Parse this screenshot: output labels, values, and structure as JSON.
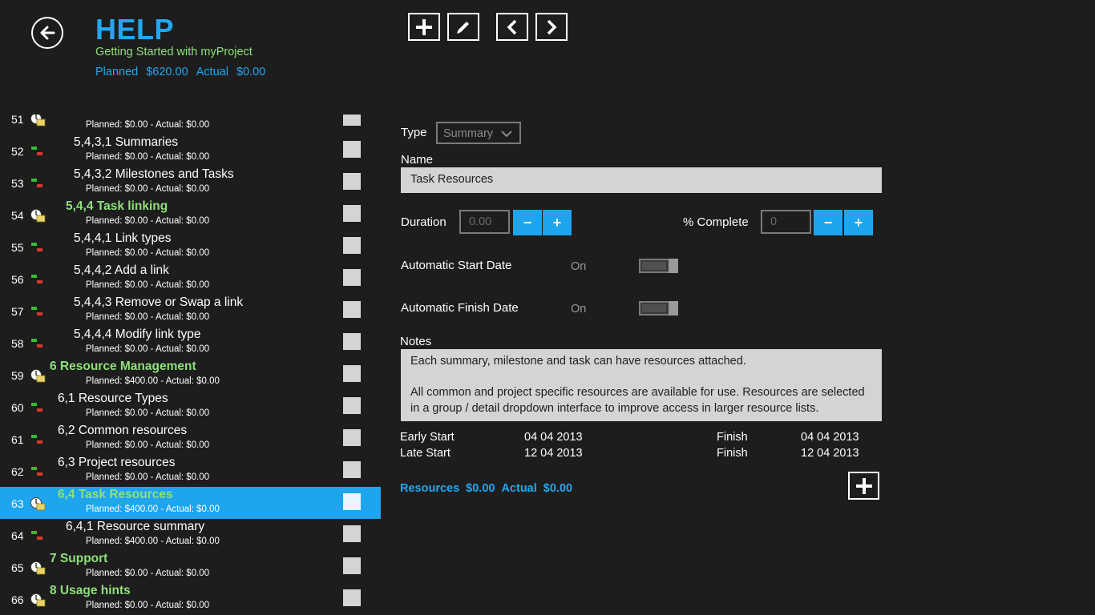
{
  "header": {
    "title": "HELP",
    "subtitle": "Getting Started with myProject",
    "planned_label": "Planned",
    "planned_value": "$620.00",
    "actual_label": "Actual",
    "actual_value": "$0.00"
  },
  "toolbar": {
    "add_icon": "plus-icon",
    "edit_icon": "pencil-icon",
    "prev_icon": "chevron-left-icon",
    "next_icon": "chevron-right-icon"
  },
  "tasks": [
    {
      "num": "51",
      "name": "",
      "cost": "Planned: $0.00  -  Actual: $0.00",
      "summary": true,
      "indent": 0
    },
    {
      "num": "52",
      "name": "5,4,3,1 Summaries",
      "cost": "Planned: $0.00  -  Actual: $0.00",
      "summary": false,
      "indent": 3
    },
    {
      "num": "53",
      "name": "5,4,3,2 Milestones and Tasks",
      "cost": "Planned: $0.00  -  Actual: $0.00",
      "summary": false,
      "indent": 3
    },
    {
      "num": "54",
      "name": "5,4,4 Task linking",
      "cost": "Planned: $0.00  -  Actual: $0.00",
      "summary": true,
      "indent": 2
    },
    {
      "num": "55",
      "name": "5,4,4,1 Link types",
      "cost": "Planned: $0.00  -  Actual: $0.00",
      "summary": false,
      "indent": 3
    },
    {
      "num": "56",
      "name": "5,4,4,2 Add a link",
      "cost": "Planned: $0.00  -  Actual: $0.00",
      "summary": false,
      "indent": 3
    },
    {
      "num": "57",
      "name": "5,4,4,3 Remove or Swap a link",
      "cost": "Planned: $0.00  -  Actual: $0.00",
      "summary": false,
      "indent": 3
    },
    {
      "num": "58",
      "name": "5,4,4,4 Modify link type",
      "cost": "Planned: $0.00  -  Actual: $0.00",
      "summary": false,
      "indent": 3
    },
    {
      "num": "59",
      "name": "6 Resource Management",
      "cost": "Planned: $400.00  -  Actual: $0.00",
      "summary": true,
      "indent": 0
    },
    {
      "num": "60",
      "name": "6,1 Resource Types",
      "cost": "Planned: $0.00  -  Actual: $0.00",
      "summary": false,
      "indent": 1
    },
    {
      "num": "61",
      "name": "6,2 Common resources",
      "cost": "Planned: $0.00  -  Actual: $0.00",
      "summary": false,
      "indent": 1
    },
    {
      "num": "62",
      "name": "6,3 Project resources",
      "cost": "Planned: $0.00  -  Actual: $0.00",
      "summary": false,
      "indent": 1
    },
    {
      "num": "63",
      "name": "6,4 Task Resources",
      "cost": "Planned: $400.00  -  Actual: $0.00",
      "summary": true,
      "indent": 1,
      "selected": true
    },
    {
      "num": "64",
      "name": "6,4,1 Resource summary",
      "cost": "Planned: $400.00  -  Actual: $0.00",
      "summary": false,
      "indent": 2
    },
    {
      "num": "65",
      "name": "7 Support",
      "cost": "Planned: $0.00  -  Actual: $0.00",
      "summary": true,
      "indent": 0
    },
    {
      "num": "66",
      "name": "8 Usage hints",
      "cost": "Planned: $0.00  -  Actual: $0.00",
      "summary": true,
      "indent": 0
    }
  ],
  "detail": {
    "type_label": "Type",
    "type_value": "Summary",
    "name_label": "Name",
    "name_value": "Task Resources",
    "duration_label": "Duration",
    "duration_placeholder": "0.00",
    "complete_label": "% Complete",
    "complete_placeholder": "0",
    "minus": "−",
    "plus": "+",
    "auto_start_label": "Automatic Start Date",
    "auto_start_state": "On",
    "auto_finish_label": "Automatic Finish Date",
    "auto_finish_state": "On",
    "notes_label": "Notes",
    "notes_value": "Each summary, milestone and task can have resources attached.\n\nAll common and project specific resources are available for use. Resources are selected in a group / detail dropdown interface to improve access in larger resource lists.",
    "early_start_label": "Early Start",
    "early_start_value": "04 04 2013",
    "early_finish_label": "Finish",
    "early_finish_value": "04 04 2013",
    "late_start_label": "Late Start",
    "late_start_value": "12 04 2013",
    "late_finish_label": "Finish",
    "late_finish_value": "12 04 2013",
    "resources_label": "Resources",
    "resources_value": "$0.00",
    "resources_actual_label": "Actual",
    "resources_actual_value": "$0.00"
  },
  "colors": {
    "accent": "#1ea5ee",
    "summary_green": "#8ee07a",
    "background": "#1d1d1d",
    "field": "#d4d4d4"
  }
}
